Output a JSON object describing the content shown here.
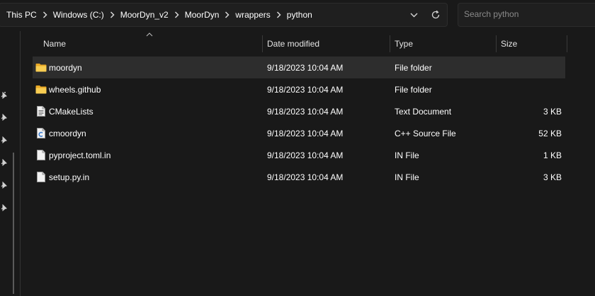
{
  "address": {
    "crumbs": [
      "This PC",
      "Windows (C:)",
      "MoorDyn_v2",
      "MoorDyn",
      "wrappers",
      "python"
    ]
  },
  "search": {
    "placeholder": "Search python"
  },
  "columns": {
    "name": "Name",
    "date": "Date modified",
    "type": "Type",
    "size": "Size"
  },
  "files": [
    {
      "name": "moordyn",
      "date": "9/18/2023 10:04 AM",
      "type": "File folder",
      "size": "",
      "icon": "folder-icon",
      "selected": true
    },
    {
      "name": "wheels.github",
      "date": "9/18/2023 10:04 AM",
      "type": "File folder",
      "size": "",
      "icon": "folder-icon",
      "selected": false
    },
    {
      "name": "CMakeLists",
      "date": "9/18/2023 10:04 AM",
      "type": "Text Document",
      "size": "3 KB",
      "icon": "text-document-icon",
      "selected": false
    },
    {
      "name": "cmoordyn",
      "date": "9/18/2023 10:04 AM",
      "type": "C++ Source File",
      "size": "52 KB",
      "icon": "cpp-source-icon",
      "selected": false
    },
    {
      "name": "pyproject.toml.in",
      "date": "9/18/2023 10:04 AM",
      "type": "IN File",
      "size": "1 KB",
      "icon": "blank-file-icon",
      "selected": false
    },
    {
      "name": "setup.py.in",
      "date": "9/18/2023 10:04 AM",
      "type": "IN File",
      "size": "3 KB",
      "icon": "blank-file-icon",
      "selected": false
    }
  ],
  "colors": {
    "background": "#191919",
    "selected_row": "#2d2d2d",
    "folder": "#f4c44a"
  }
}
